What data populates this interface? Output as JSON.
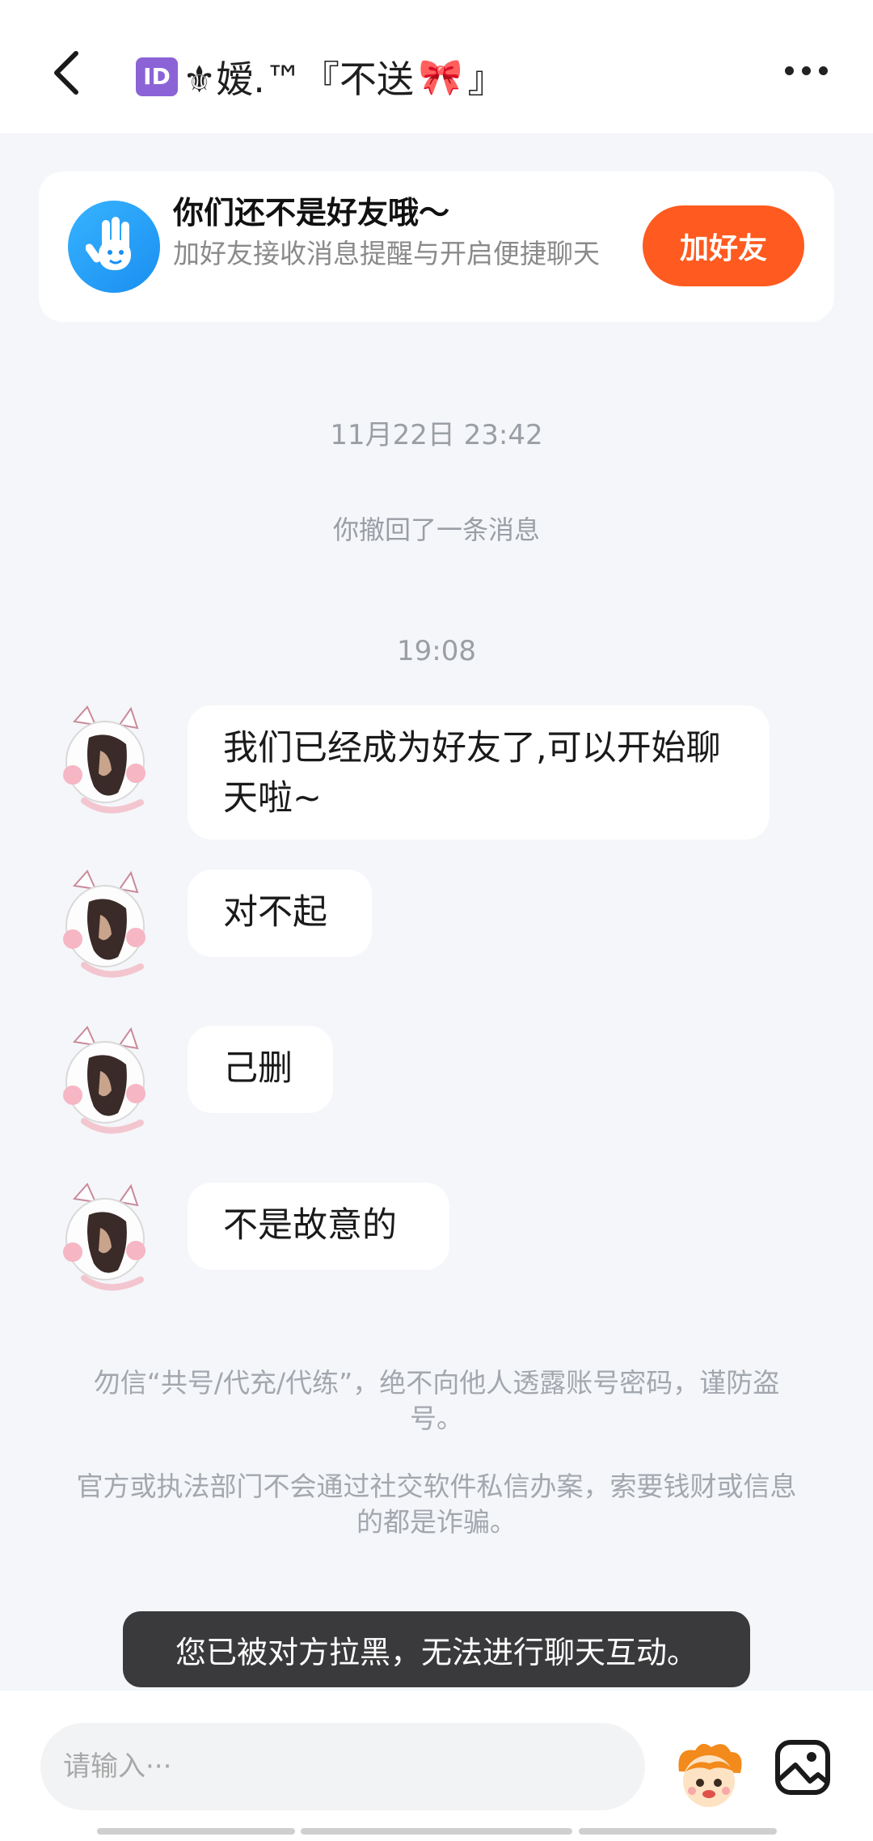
{
  "header": {
    "id_badge": "ID",
    "title_text": "⚜嫒.™『不送",
    "title_suffix": "』",
    "bow_emoji": "🎀"
  },
  "banner": {
    "title": "你们还不是好友哦～",
    "subtitle": "加好友接收消息提醒与开启便捷聊天",
    "add_button": "加好友"
  },
  "chat": {
    "timestamp_1": "11月22日 23:42",
    "recall_notice": "你撤回了一条消息",
    "timestamp_2": "19:08",
    "messages": [
      {
        "text": "我们已经成为好友了,可以开始聊天啦~"
      },
      {
        "text": "对不起"
      },
      {
        "text": "己删"
      },
      {
        "text": "不是故意的"
      }
    ]
  },
  "notices": {
    "warning_1": "勿信“共号/代充/代练”，绝不向他人透露账号密码，谨防盗号。",
    "warning_2": "官方或执法部门不会通过社交软件私信办案，索要钱财或信息的都是诈骗。"
  },
  "toast": "您已被对方拉黑，无法进行聊天互动。",
  "input": {
    "placeholder": "请输入···"
  },
  "colors": {
    "accent": "#ff5a1f",
    "hand_icon_bg": "#1a8ff0",
    "page_bg": "#f4f6f9"
  },
  "icons": {
    "back": "chevron-left-icon",
    "more": "more-dots-icon",
    "hand": "hand-wave-icon",
    "emoji": "emoji-mascot-icon",
    "photo": "image-icon"
  }
}
